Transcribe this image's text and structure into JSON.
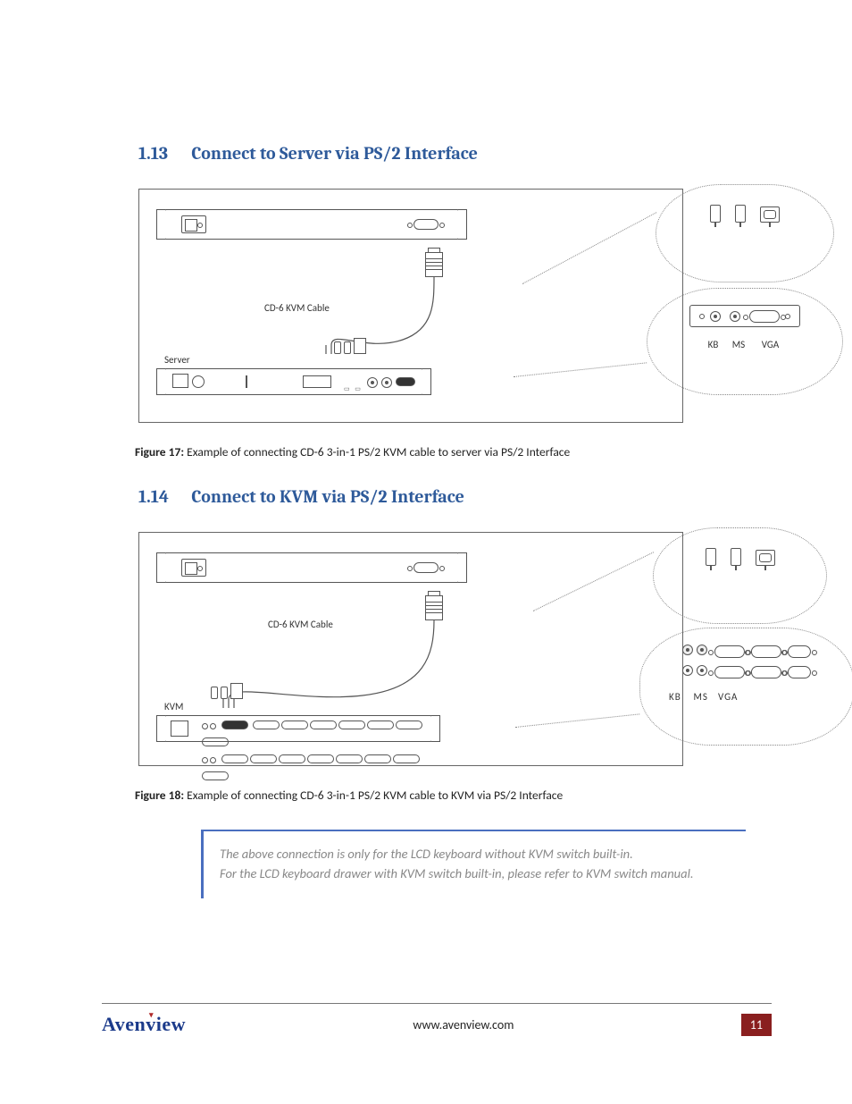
{
  "sections": {
    "s113": {
      "number": "1.13",
      "title": "Connect to Server via PS/2 Interface"
    },
    "s114": {
      "number": "1.14",
      "title": "Connect to KVM via PS/2 Interface"
    }
  },
  "figures": {
    "f17": {
      "label": "Figure 17:",
      "caption": "Example of connecting CD-6 3-in-1 PS/2 KVM cable to server via PS/2 Interface",
      "cable_label": "CD-6 KVM Cable",
      "device_label": "Server",
      "callout_labels": {
        "kb": "KB",
        "ms": "MS",
        "vga": "VGA"
      }
    },
    "f18": {
      "label": "Figure 18:",
      "caption": "Example of connecting CD-6 3-in-1 PS/2 KVM cable to KVM via PS/2 Interface",
      "cable_label": "CD-6 KVM Cable",
      "device_label": "KVM",
      "callout_labels": {
        "kb": "KB",
        "ms": "MS",
        "vga": "VGA"
      }
    }
  },
  "note": {
    "line1": "The above connection is only for the LCD keyboard without KVM switch built-in.",
    "line2": "For the LCD keyboard drawer with KVM switch built-in, please refer to KVM switch manual."
  },
  "footer": {
    "brand": "Avenview",
    "url": "www.avenview.com",
    "page": "11"
  }
}
